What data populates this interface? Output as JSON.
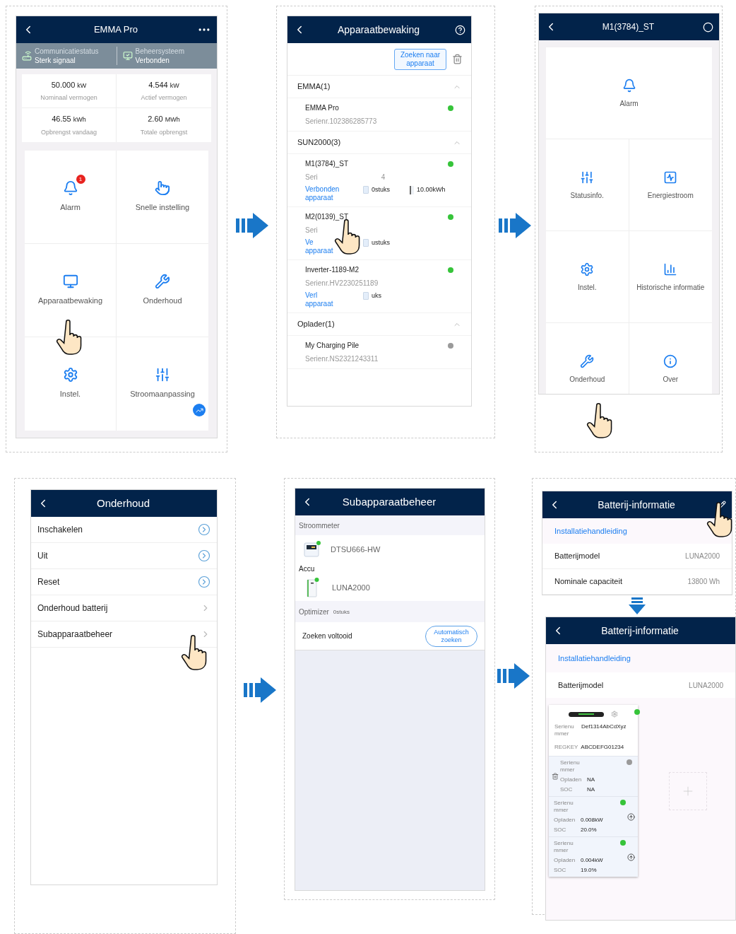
{
  "home": {
    "title": "EMMA Pro",
    "status": [
      {
        "label": "Communicatiestatus",
        "value": "Sterk signaal"
      },
      {
        "label": "Beheersysteem",
        "value": "Verbonden"
      }
    ],
    "stats": [
      {
        "value": "50.000",
        "unit": "kW",
        "label": "Nominaal vermogen"
      },
      {
        "value": "4.544",
        "unit": "kW",
        "label": "Actief vermogen"
      },
      {
        "value": "46.55",
        "unit": "kWh",
        "label": "Opbrengst vandaag"
      },
      {
        "value": "2.60",
        "unit": "MWh",
        "label": "Totale opbrengst"
      }
    ],
    "tiles": [
      {
        "label": "Alarm",
        "badge": "1"
      },
      {
        "label": "Snelle instelling"
      },
      {
        "label": "Apparaatbewaking"
      },
      {
        "label": "Onderhoud"
      },
      {
        "label": "Instel."
      },
      {
        "label": "Stroomaanpassing"
      }
    ]
  },
  "monitoring": {
    "title": "Apparaatbewaking",
    "search_button": "Zoeken naar apparaat",
    "groups": [
      {
        "title": "EMMA(1)",
        "expanded": true,
        "devices": [
          {
            "name": "EMMA Pro",
            "serial": "Serienr.102386285773",
            "online": true
          }
        ]
      },
      {
        "title": "SUN2000(3)",
        "expanded": true,
        "devices": [
          {
            "name": "M1(3784)_ST",
            "serial": "Seri",
            "serial_tail": "4",
            "link": "Verbonden apparaat",
            "optimizers": "0stuks",
            "battery": "10.00kWh",
            "online": true
          },
          {
            "name": "M2(0139)_ST",
            "serial": "Seri",
            "link": "Ve apparaat",
            "optimizers": "ustuks",
            "online": true
          },
          {
            "name": "Inverter-1189-M2",
            "serial": "Serienr.HV2230251189",
            "link": "Verl apparaat",
            "optimizers": "uks",
            "online": true
          }
        ]
      },
      {
        "title": "Oplader(1)",
        "expanded": true,
        "devices": [
          {
            "name": "My Charging Pile",
            "serial": "Serienr.NS2321243311",
            "online": false
          }
        ]
      }
    ]
  },
  "device": {
    "title": "M1(3784)_ST",
    "tiles": [
      {
        "label": "Alarm"
      },
      {
        "label": "Statusinfo."
      },
      {
        "label": "Energiestroom"
      },
      {
        "label": "Instel."
      },
      {
        "label": "Historische informatie"
      },
      {
        "label": "Onderhoud"
      },
      {
        "label": "Over"
      }
    ]
  },
  "maintenance": {
    "title": "Onderhoud",
    "items": [
      {
        "label": "Inschakelen",
        "kind": "action"
      },
      {
        "label": "Uit",
        "kind": "action"
      },
      {
        "label": "Reset",
        "kind": "action"
      },
      {
        "label": "Onderhoud batterij",
        "kind": "nav"
      },
      {
        "label": "Subapparaatbeheer",
        "kind": "nav"
      }
    ]
  },
  "subdevices": {
    "title": "Subapparaatbeheer",
    "meter_header": "Stroommeter",
    "meter": {
      "name": "DTSU666-HW",
      "online": true
    },
    "battery_header": "Accu",
    "battery": {
      "name": "LUNA2000",
      "online": true
    },
    "optimizer": {
      "label": "Optimizer",
      "count": "0stuks"
    },
    "search": {
      "status": "Zoeken voltooid",
      "button": "Automatisch zoeken"
    }
  },
  "battery_before": {
    "title": "Batterij-informatie",
    "link": "Installatiehandleiding",
    "rows": [
      {
        "label": "Batterijmodel",
        "value": "LUNA2000"
      },
      {
        "label": "Nominale capaciteit",
        "value": "13800 Wh"
      }
    ]
  },
  "battery_after": {
    "title": "Batterij-informatie",
    "link": "Installatiehandleiding",
    "rows": [
      {
        "label": "Batterijmodel",
        "value": "LUNA2000"
      }
    ],
    "card": {
      "online": true,
      "serial_label": "Serienummer",
      "serial": "Def1314AbCdXyz",
      "regkey_label": "REGKEY",
      "regkey": "ABCDEFG01234",
      "modules": [
        {
          "kind": "removable",
          "online": false,
          "serial_label": "Serienummer",
          "charge_label": "Opladen",
          "charge": "NA",
          "soc_label": "SOC",
          "soc": "NA"
        },
        {
          "kind": "upgradable",
          "online": true,
          "serial_label": "Serienummer",
          "charge_label": "Opladen",
          "charge": "0.008kW",
          "soc_label": "SOC",
          "soc": "20.0%"
        },
        {
          "kind": "upgradable",
          "online": true,
          "serial_label": "Serienummer",
          "charge_label": "Opladen",
          "charge": "0.004kW",
          "soc_label": "SOC",
          "soc": "19.0%"
        }
      ]
    }
  }
}
